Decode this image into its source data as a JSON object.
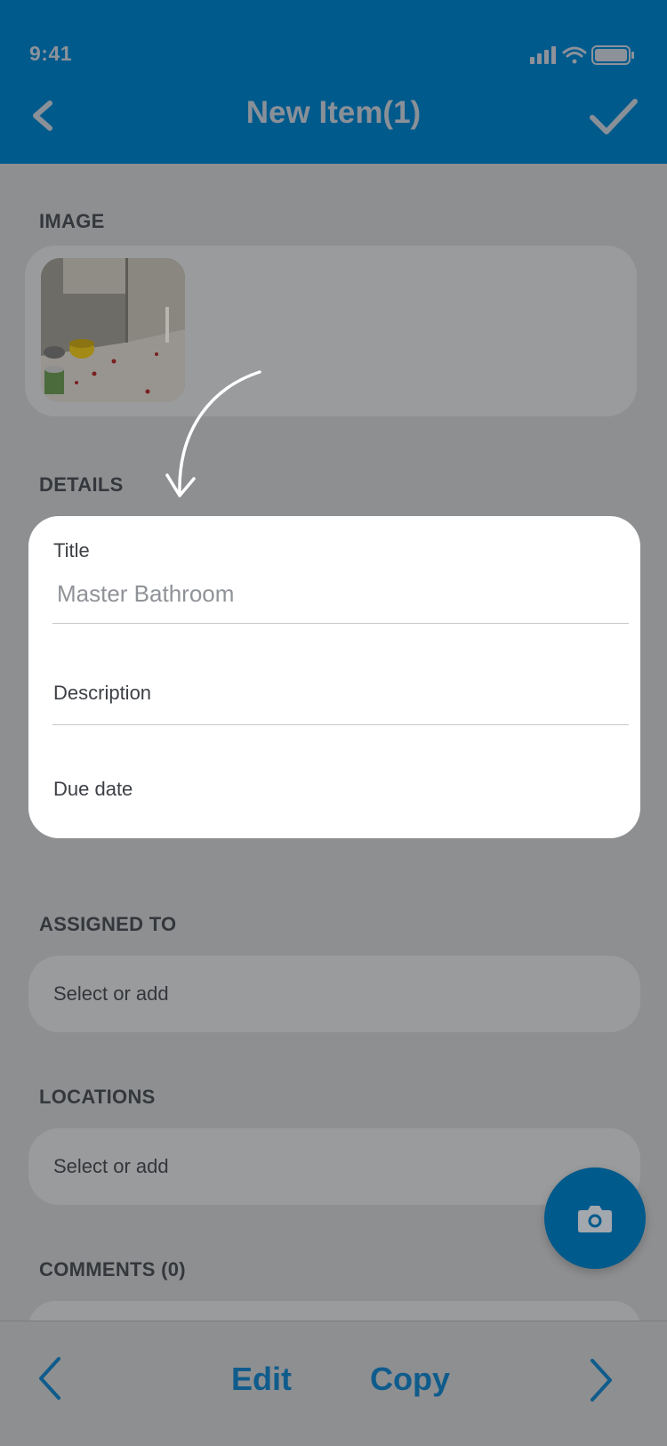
{
  "status_bar": {
    "time": "9:41"
  },
  "header": {
    "title": "New Item(1)"
  },
  "image_section": {
    "label": "IMAGE"
  },
  "details": {
    "label": "DETAILS",
    "title_label": "Title",
    "title_value": "Master Bathroom",
    "description_label": "Description",
    "due_date_label": "Due date"
  },
  "assigned_to": {
    "label": "ASSIGNED TO",
    "placeholder": "Select or add"
  },
  "locations": {
    "label": "LOCATIONS",
    "placeholder": "Select or add"
  },
  "comments": {
    "label": "COMMENTS (0)"
  },
  "bottom_bar": {
    "edit_label": "Edit",
    "copy_label": "Copy"
  },
  "colors": {
    "brand": "#005a8c",
    "overlay": "#8e8f91",
    "card": "#ffffff"
  },
  "icons": [
    "back-icon",
    "check-icon",
    "camera-icon",
    "chevron-left-icon",
    "chevron-right-icon"
  ]
}
